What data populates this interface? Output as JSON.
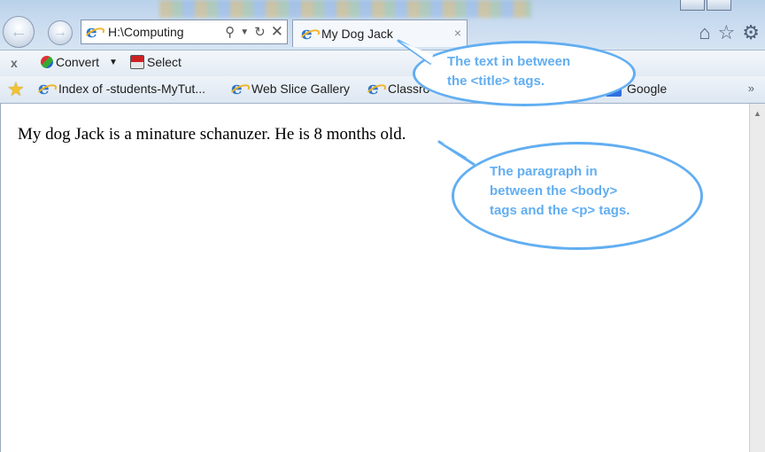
{
  "browser": {
    "address": "H:\\Computing",
    "tab_title": "My Dog Jack",
    "tab_close": "×"
  },
  "commandbar": {
    "close": "x",
    "convert_label": "Convert",
    "convert_arrow": "▼",
    "select_label": "Select"
  },
  "favorites": {
    "items": [
      {
        "label": "Index of -students-MyTut..."
      },
      {
        "label": "Web Slice Gallery"
      },
      {
        "label": "Classro"
      },
      {
        "label": "Google"
      }
    ],
    "overflow": "»"
  },
  "page": {
    "paragraph": "My dog Jack is a minature schanuzer. He is 8 months old."
  },
  "callouts": {
    "title_note": [
      "The text in between",
      "the <title> tags."
    ],
    "body_note": [
      "The paragraph in",
      "between the <body>",
      "tags and the <p> tags."
    ]
  },
  "colors": {
    "callout": "#62aef1",
    "ie_blue": "#2d76c8",
    "star_yellow": "#f2c230"
  },
  "icons": [
    "back-arrow-icon",
    "forward-arrow-icon",
    "search-icon",
    "refresh-icon",
    "stop-icon",
    "home-icon",
    "favorites-star-icon",
    "gear-icon",
    "ie-logo-icon"
  ]
}
